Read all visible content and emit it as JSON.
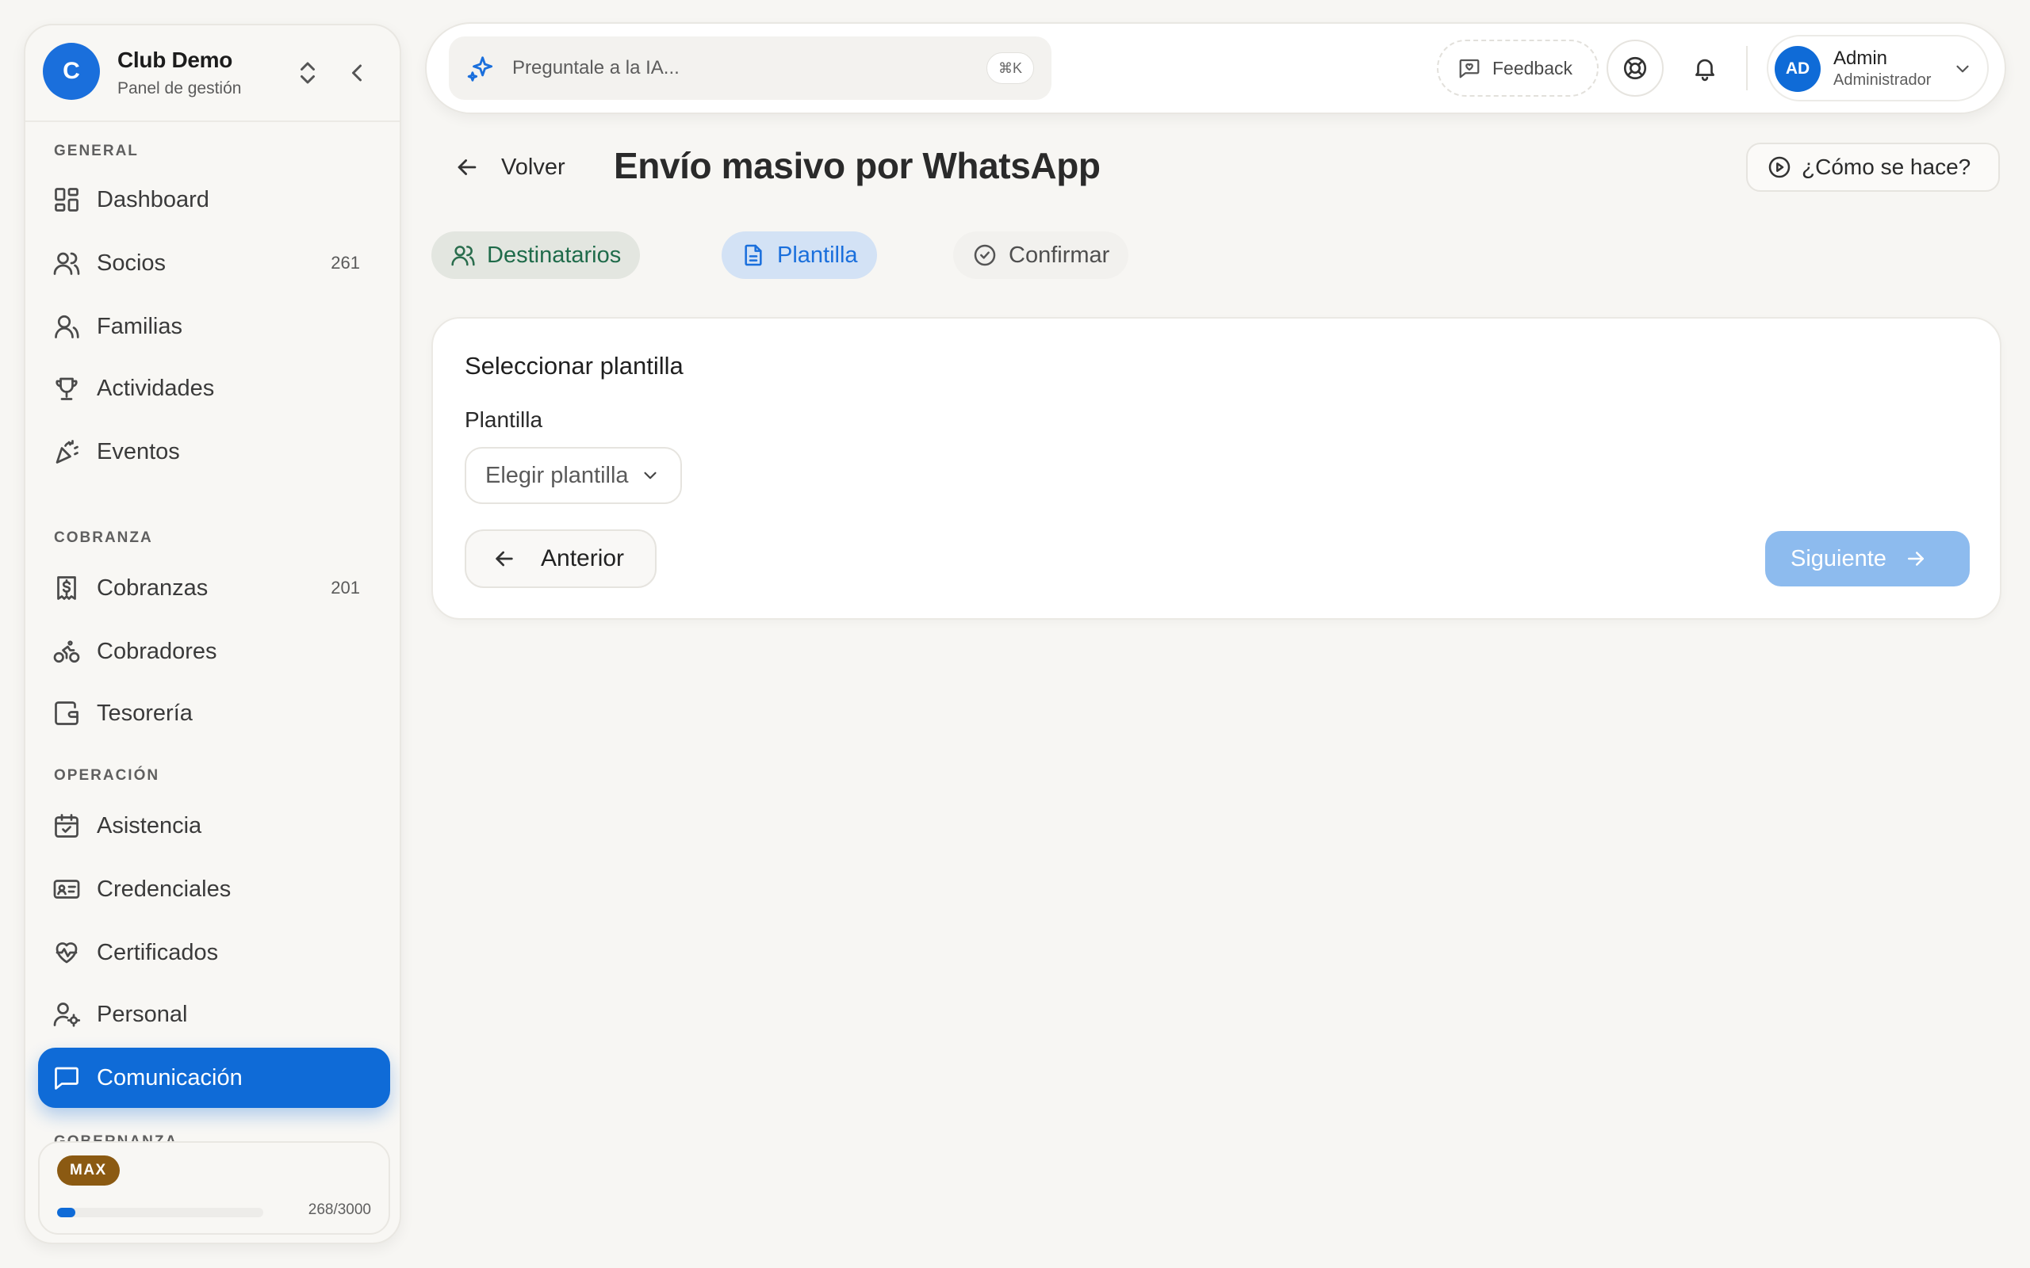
{
  "brand": {
    "initial": "C",
    "name": "Club Demo",
    "subtitle": "Panel de gestión"
  },
  "sidebar": {
    "sections": {
      "general": "GENERAL",
      "cobranza": "COBRANZA",
      "operacion": "OPERACIÓN",
      "gobernanza": "GOBERNANZA"
    },
    "items": [
      {
        "label": "Dashboard",
        "icon": "dashboard-icon"
      },
      {
        "label": "Socios",
        "icon": "users-icon",
        "count": "261"
      },
      {
        "label": "Familias",
        "icon": "family-icon"
      },
      {
        "label": "Actividades",
        "icon": "trophy-icon"
      },
      {
        "label": "Eventos",
        "icon": "party-icon"
      },
      {
        "label": "Cobranzas",
        "icon": "receipt-icon",
        "count": "201"
      },
      {
        "label": "Cobradores",
        "icon": "bike-icon"
      },
      {
        "label": "Tesorería",
        "icon": "wallet-icon"
      },
      {
        "label": "Asistencia",
        "icon": "calendar-check-icon"
      },
      {
        "label": "Credenciales",
        "icon": "id-card-icon"
      },
      {
        "label": "Certificados",
        "icon": "heart-pulse-icon"
      },
      {
        "label": "Personal",
        "icon": "user-gear-icon"
      },
      {
        "label": "Comunicación",
        "icon": "message-icon",
        "active": true
      }
    ],
    "plan": {
      "badge": "MAX",
      "usage": "268/3000",
      "usage_fraction": 0.089
    }
  },
  "topbar": {
    "ai_placeholder": "Preguntale a la IA...",
    "shortcut": "⌘K",
    "feedback_label": "Feedback",
    "user": {
      "initials": "AD",
      "name": "Admin",
      "role": "Administrador"
    }
  },
  "page": {
    "back_label": "Volver",
    "title": "Envío masivo por WhatsApp",
    "howto_label": "¿Cómo se hace?",
    "steps": [
      {
        "label": "Destinatarios",
        "state": "completed"
      },
      {
        "label": "Plantilla",
        "state": "current"
      },
      {
        "label": "Confirmar",
        "state": "pending"
      }
    ]
  },
  "card": {
    "title": "Seleccionar plantilla",
    "field_label": "Plantilla",
    "select_placeholder": "Elegir plantilla",
    "prev_label": "Anterior",
    "next_label": "Siguiente",
    "next_disabled": true
  },
  "colors": {
    "accent": "#0f6bd7",
    "next_disabled_bg": "#8dbbee",
    "plan_badge": "#8b5a12",
    "step_completed_text": "#1f6b4a"
  }
}
